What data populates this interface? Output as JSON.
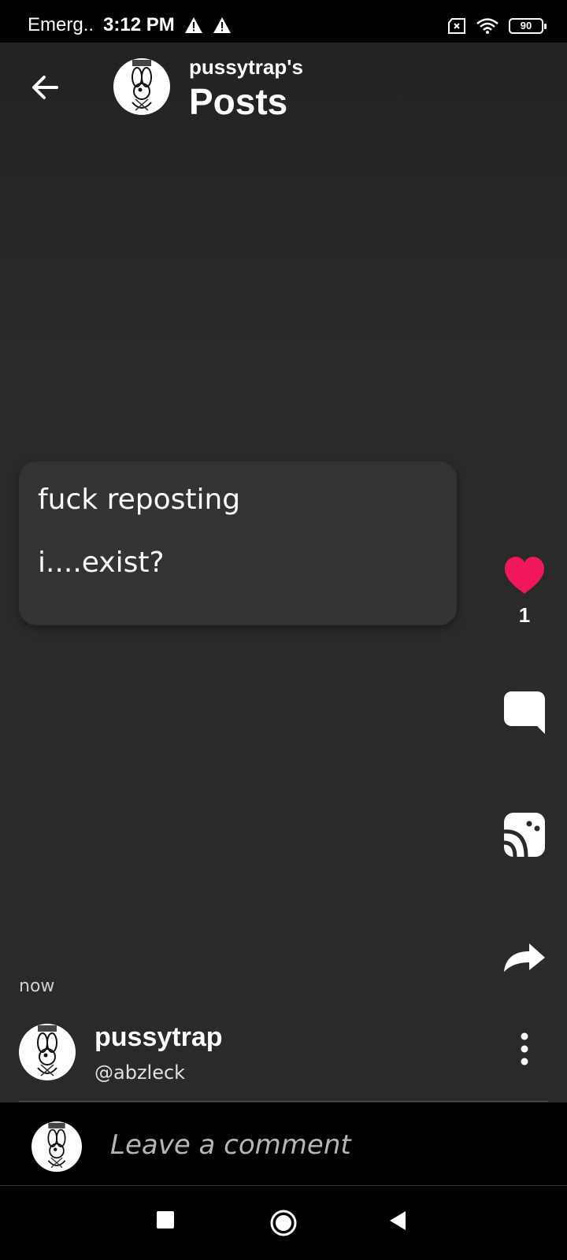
{
  "status_bar": {
    "carrier": "Emerg..",
    "time": "3:12 PM",
    "battery": "90",
    "icons": [
      "warning-icon",
      "warning-icon",
      "no-sim-icon",
      "wifi-icon",
      "battery-icon"
    ]
  },
  "header": {
    "subtitle": "pussytrap's",
    "title": "Posts"
  },
  "post": {
    "title": "fuck reposting",
    "body": "i....exist?",
    "timestamp": "now",
    "like_count": "1"
  },
  "author": {
    "name": "pussytrap",
    "handle": "@abzleck"
  },
  "comment": {
    "placeholder": "Leave a comment"
  },
  "colors": {
    "accent_like": "#f0185a",
    "background": "#2a2a2a",
    "card": "#333333"
  }
}
